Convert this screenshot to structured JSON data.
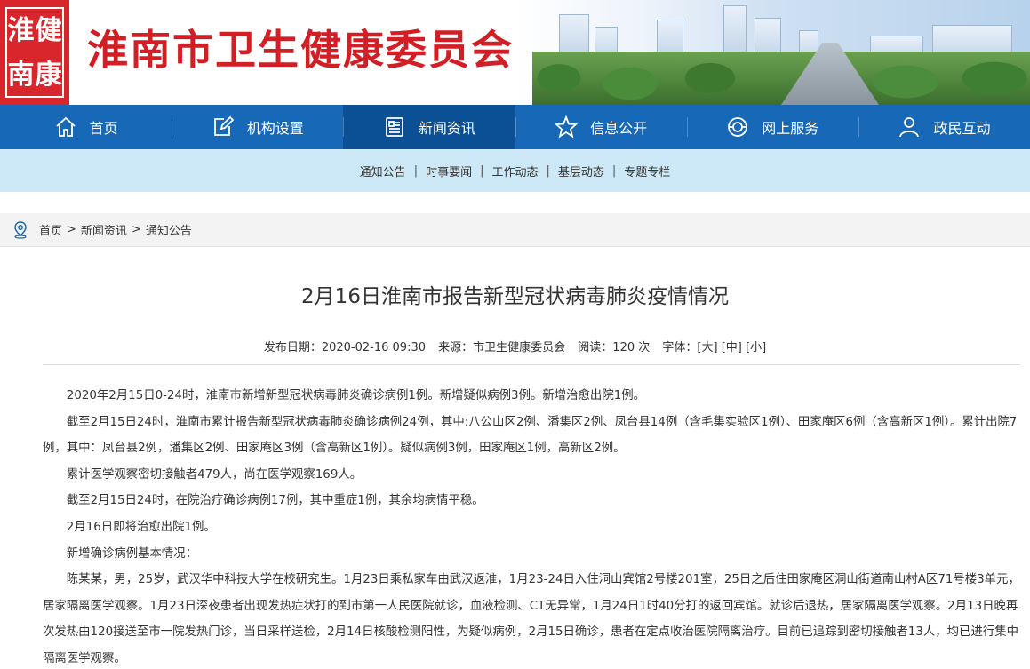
{
  "header": {
    "seal_chars": [
      "淮",
      "健",
      "南",
      "康"
    ],
    "site_title": "淮南市卫生健康委员会"
  },
  "nav": {
    "items": [
      {
        "label": "首页",
        "icon": "home-icon"
      },
      {
        "label": "机构设置",
        "icon": "edit-icon"
      },
      {
        "label": "新闻资讯",
        "icon": "news-icon"
      },
      {
        "label": "信息公开",
        "icon": "star-icon"
      },
      {
        "label": "网上服务",
        "icon": "globe-icon"
      },
      {
        "label": "政民互动",
        "icon": "user-icon"
      }
    ],
    "active_index": 2
  },
  "subnav": {
    "items": [
      "通知公告",
      "时事要闻",
      "工作动态",
      "基层动态",
      "专题专栏"
    ]
  },
  "breadcrumb": {
    "items": [
      "首页",
      "新闻资讯",
      "通知公告"
    ],
    "separator": ">"
  },
  "article": {
    "title": "2月16日淮南市报告新型冠状病毒肺炎疫情情况",
    "meta": {
      "date_label": "发布日期：2020-02-16 09:30",
      "source_label": "来源：市卫生健康委员会",
      "views_label": "阅读：120 次",
      "font_label": "字体：",
      "font_large": "[大]",
      "font_medium": "[中]",
      "font_small": "[小]"
    },
    "paragraphs": [
      "2020年2月15日0-24时，淮南市新增新型冠状病毒肺炎确诊病例1例。新增疑似病例3例。新增治愈出院1例。",
      "截至2月15日24时，淮南市累计报告新型冠状病毒肺炎确诊病例24例，其中:八公山区2例、潘集区2例、凤台县14例（含毛集实验区1例）、田家庵区6例（含高新区1例）。累计出院7例，其中：凤台县2例，潘集区2例、田家庵区3例（含高新区1例）。疑似病例3例，田家庵区1例，高新区2例。",
      "累计医学观察密切接触者479人，尚在医学观察169人。",
      "截至2月15日24时，在院治疗确诊病例17例，其中重症1例，其余均病情平稳。",
      "2月16日即将治愈出院1例。",
      "新增确诊病例基本情况：",
      "陈某某，男，25岁，武汉华中科技大学在校研究生。1月23日乘私家车由武汉返淮，1月23-24日入住洞山宾馆2号楼201室，25日之后住田家庵区洞山街道南山村A区71号楼3单元，居家隔离医学观察。1月23日深夜患者出现发热症状打的到市第一人民医院就诊，血液检测、CT无异常，1月24日1时40分打的返回宾馆。就诊后退热，居家隔离医学观察。2月13日晚再次发热由120接送至市一院发热门诊，当日采样送检，2月14日核酸检测阳性，为疑似病例，2月15日确诊，患者在定点收治医院隔离治疗。目前已追踪到密切接触者13人，均已进行集中隔离医学观察。"
    ]
  },
  "colors": {
    "brand_red": "#d21f26",
    "nav_blue": "#1769b7",
    "nav_active": "#0b4f95",
    "subnav_bg": "#cde8f6"
  }
}
